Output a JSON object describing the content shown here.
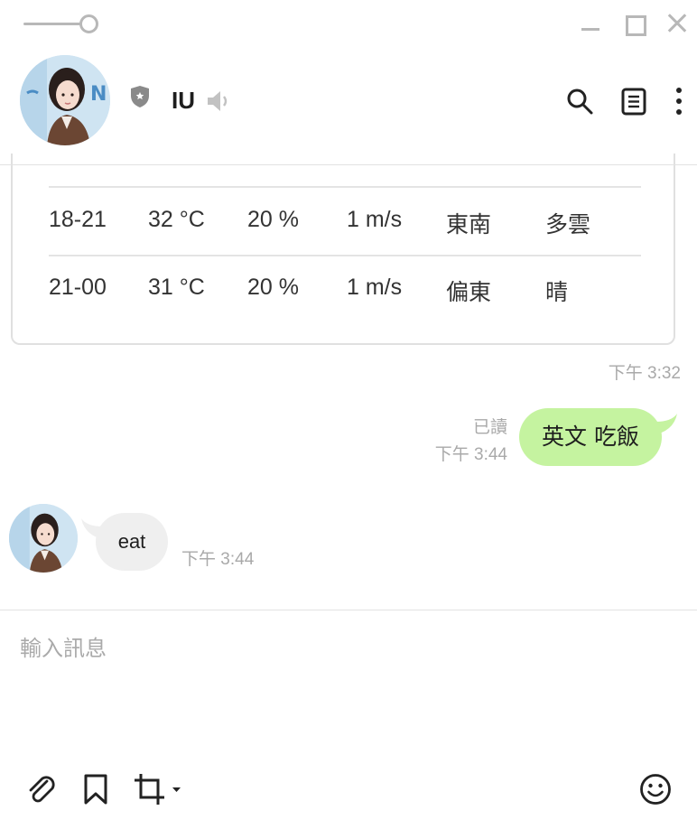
{
  "window": {
    "controls": [
      "minimize",
      "maximize",
      "close"
    ]
  },
  "header": {
    "contact_name": "IU",
    "icons": [
      "shield-icon",
      "speaker-icon",
      "search-icon",
      "notes-icon",
      "more-icon"
    ]
  },
  "weather_card": {
    "rows": [
      {
        "time": "18-21",
        "temp": "32 °C",
        "rain": "20 %",
        "wind_speed": "1 m/s",
        "wind_dir": "東南",
        "condition": "多雲"
      },
      {
        "time": "21-00",
        "temp": "31 °C",
        "rain": "20 %",
        "wind_speed": "1 m/s",
        "wind_dir": "偏東",
        "condition": "晴"
      }
    ],
    "timestamp": "下午 3:32"
  },
  "messages": {
    "outgoing": {
      "text": "英文 吃飯",
      "read_status": "已讀",
      "timestamp": "下午 3:44",
      "color": "#c5f3a0"
    },
    "incoming": {
      "text": "eat",
      "timestamp": "下午 3:44",
      "color": "#efefef"
    }
  },
  "composer": {
    "placeholder": "輸入訊息",
    "value": "",
    "tools": [
      "attach-icon",
      "bookmark-icon",
      "crop-icon",
      "emoji-icon"
    ]
  }
}
